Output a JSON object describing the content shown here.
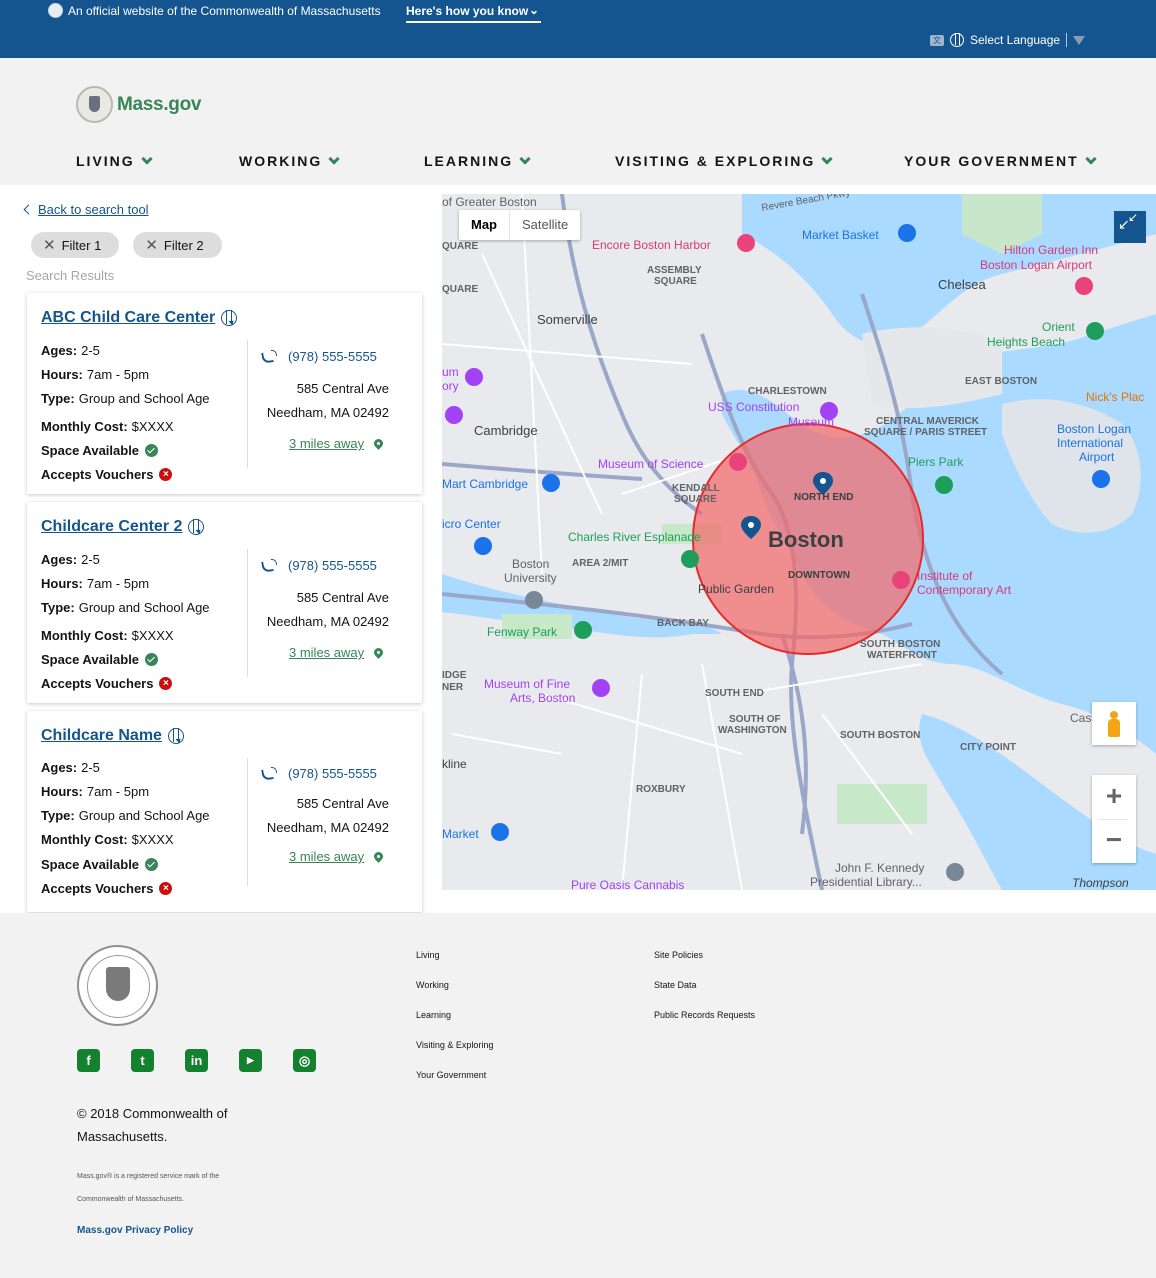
{
  "banner": {
    "official_text": "An official website of the Commonwealth of Massachusetts",
    "how_you_know": "Here's how you know",
    "select_language": "Select Language"
  },
  "header": {
    "logo_text": "Mass.gov",
    "nav": [
      {
        "label": "LIVING"
      },
      {
        "label": "WORKING"
      },
      {
        "label": "LEARNING"
      },
      {
        "label": "VISITING & EXPLORING"
      },
      {
        "label": "YOUR GOVERNMENT"
      }
    ]
  },
  "results": {
    "back_link": "Back to search tool",
    "filters": [
      "Filter 1",
      "Filter 2"
    ],
    "search_results_label": "Search Results",
    "labels": {
      "ages": "Ages:",
      "hours": "Hours:",
      "type": "Type:",
      "monthly_cost": "Monthly Cost:",
      "space_available": "Space Available",
      "accepts_vouchers": "Accepts Vouchers"
    },
    "cards": [
      {
        "name": "ABC Child Care Center",
        "ages": "2-5",
        "hours": "7am - 5pm",
        "type": "Group and School Age",
        "monthly_cost": "$XXXX",
        "phone": "(978) 555-5555",
        "address_line1": "585 Central Ave",
        "address_line2": "Needham, MA 02492",
        "distance": "3 miles away",
        "space_available": true,
        "accepts_vouchers": false
      },
      {
        "name": "Childcare Center 2",
        "ages": "2-5",
        "hours": "7am - 5pm",
        "type": "Group and School Age",
        "monthly_cost": "$XXXX",
        "phone": "(978) 555-5555",
        "address_line1": "585 Central Ave",
        "address_line2": "Needham, MA 02492",
        "distance": "3 miles away",
        "space_available": true,
        "accepts_vouchers": false
      },
      {
        "name": "Childcare Name",
        "ages": "2-5",
        "hours": "7am - 5pm",
        "type": "Group and School Age",
        "monthly_cost": "$XXXX",
        "phone": "(978) 555-5555",
        "address_line1": "585 Central Ave",
        "address_line2": "Needham, MA 02492",
        "distance": "3 miles away",
        "space_available": true,
        "accepts_vouchers": false
      }
    ]
  },
  "map": {
    "type_map": "Map",
    "type_satellite": "Satellite",
    "selected_type": "Map",
    "zoom_in": "+",
    "zoom_out": "−",
    "labels": {
      "greater_boston": "of Greater Boston",
      "revere_beach": "Revere Beach Pkwy",
      "market_basket": "Market Basket",
      "encore": "Encore Boston Harbor",
      "assembly": "ASSEMBLY",
      "square": "SQUARE",
      "hilton1": "Hilton Garden Inn",
      "hilton2": "Boston Logan Airport",
      "chelsea": "Chelsea",
      "somerville": "Somerville",
      "orient": "Orient",
      "heights_beach": "Heights Beach",
      "charlestown": "CHARLESTOWN",
      "east_boston": "EAST BOSTON",
      "nicks": "Nick's Plac",
      "uss1": "USS Constitution",
      "uss2": "Museum",
      "central_maverick1": "CENTRAL MAVERICK",
      "central_maverick2": "SQUARE / PARIS STREET",
      "logan1": "Boston Logan",
      "logan2": "International",
      "logan3": "Airport",
      "cambridge": "Cambridge",
      "museum_science": "Museum of Science",
      "piers_park": "Piers Park",
      "mart_cambridge": "Mart Cambridge",
      "kendall1": "KENDALL",
      "kendall2": "SQUARE",
      "north_end": "NORTH END",
      "boston": "Boston",
      "micro_center": "icro Center",
      "charles_esplanade": "Charles River Esplanade",
      "area2mit": "AREA 2/MIT",
      "downtown": "DOWNTOWN",
      "bu1": "Boston",
      "bu2": "University",
      "public_garden": "Public Garden",
      "ica1": "Institute of",
      "ica2": "Contemporary Art",
      "fenway": "Fenway Park",
      "back_bay": "BACK BAY",
      "south_boston_wf1": "SOUTH BOSTON",
      "south_boston_wf2": "WATERFRONT",
      "mfa1": "Museum of Fine",
      "mfa2": "Arts, Boston",
      "south_end": "SOUTH END",
      "south_of_wash1": "SOUTH OF",
      "south_of_wash2": "WASHINGTON",
      "south_boston": "SOUTH BOSTON",
      "city_point": "CITY POINT",
      "castle": "Castle Is",
      "roxbury": "ROXBURY",
      "market": "Market",
      "jfk1": "John F. Kennedy",
      "jfk2": "Presidential Library...",
      "thompson": "Thompson",
      "pure_oasis": "Pure Oasis Cannabis",
      "ridge": "IDGE",
      "ner": "NER",
      "kline": "kline",
      "quare1": "QUARE",
      "quare2": "QUARE",
      "um": "um",
      "ory": "ory"
    }
  },
  "footer": {
    "links_col1": [
      "Living",
      "Working",
      "Learning",
      "Visiting & Exploring",
      "Your Government"
    ],
    "links_col2": [
      "Site Policies",
      "State Data",
      "Public Records Requests"
    ],
    "copyright": "© 2018 Commonwealth of Massachusetts.",
    "service_mark": "Mass.gov® is a registered service mark of the Commonwealth of Massachusetts.",
    "privacy": "Mass.gov Privacy Policy"
  },
  "colors": {
    "brand_blue": "#14558f",
    "brand_green": "#388557",
    "radius_fill": "#f26a6a",
    "water": "#aadaff"
  }
}
